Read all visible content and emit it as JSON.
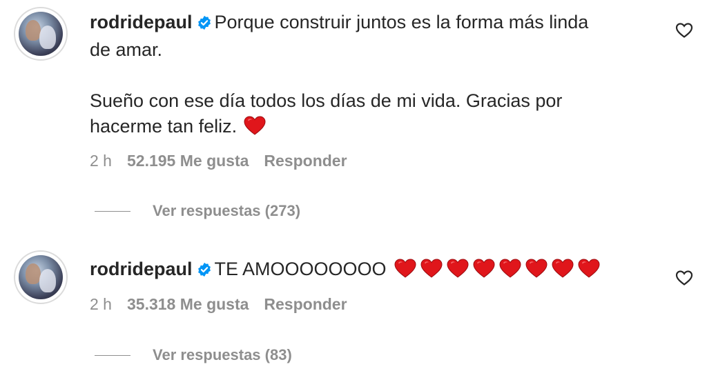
{
  "comments": [
    {
      "username": "rodridepaul",
      "line1": "Porque construir juntos es la forma más linda",
      "line2": "de amar.",
      "line3": "Sueño con ese día todos los días de mi vida. Gracias por",
      "line4": "hacerme tan feliz.",
      "time": "2 h",
      "likes": "52.195 Me gusta",
      "reply": "Responder",
      "view_replies": "Ver respuestas (273)"
    },
    {
      "username": "rodridepaul",
      "text": "TE AMOOOOOOOO",
      "time": "2 h",
      "likes": "35.318 Me gusta",
      "reply": "Responder",
      "view_replies": "Ver respuestas (83)"
    }
  ],
  "colors": {
    "text": "#262626",
    "muted": "#8e8e8e",
    "verified": "#0095f6",
    "heart": "#e0161b"
  },
  "icons": [
    "verified-badge-icon",
    "heart-emoji-icon",
    "like-heart-outline-icon"
  ]
}
